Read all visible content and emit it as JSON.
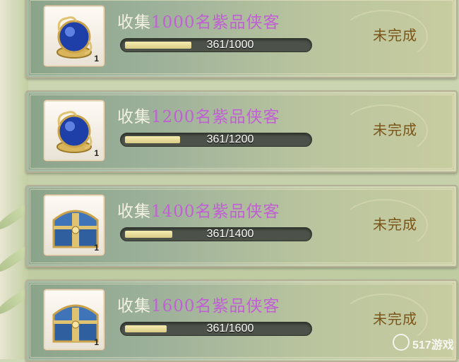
{
  "tasks": [
    {
      "prefix": "收集",
      "number": "1000",
      "suffix": "名紫品侠客",
      "progress_text": "361/1000",
      "progress": 0.361,
      "status": "未完成",
      "item_icon": "crystal-orb-icon",
      "item_count": "1"
    },
    {
      "prefix": "收集",
      "number": "1200",
      "suffix": "名紫品侠客",
      "progress_text": "361/1200",
      "progress": 0.301,
      "status": "未完成",
      "item_icon": "crystal-orb-icon",
      "item_count": "1"
    },
    {
      "prefix": "收集",
      "number": "1400",
      "suffix": "名紫品侠客",
      "progress_text": "361/1400",
      "progress": 0.258,
      "status": "未完成",
      "item_icon": "treasure-chest-icon",
      "item_count": "1"
    },
    {
      "prefix": "收集",
      "number": "1600",
      "suffix": "名紫品侠客",
      "progress_text": "361/1600",
      "progress": 0.226,
      "status": "未完成",
      "item_icon": "treasure-chest-icon",
      "item_count": "1"
    }
  ],
  "watermark": {
    "text": "517游戏"
  },
  "colors": {
    "highlight": "#c15fd5",
    "status": "#7a5519",
    "bar_fill": "#e9dd9a"
  }
}
